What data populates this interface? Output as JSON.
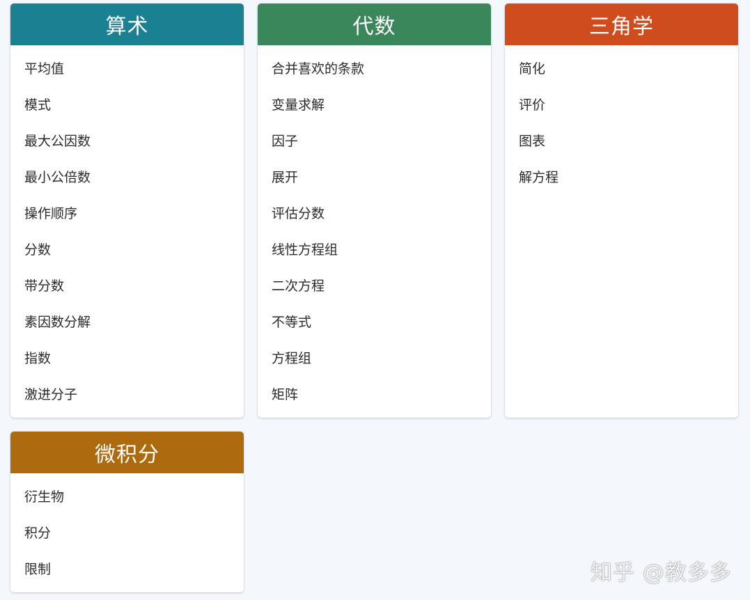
{
  "colors": {
    "arithmetic": "#1a8193",
    "algebra": "#3a875c",
    "trigonometry": "#cf4c1f",
    "calculus": "#ad6a0e",
    "background": "#f4f7fb"
  },
  "categories": [
    {
      "id": "arithmetic",
      "title": "算术",
      "items": [
        "平均值",
        "模式",
        "最大公因数",
        "最小公倍数",
        "操作顺序",
        "分数",
        "带分数",
        "素因数分解",
        "指数",
        "激进分子"
      ]
    },
    {
      "id": "algebra",
      "title": "代数",
      "items": [
        "合并喜欢的条款",
        "变量求解",
        "因子",
        "展开",
        "评估分数",
        "线性方程组",
        "二次方程",
        "不等式",
        "方程组",
        "矩阵"
      ]
    },
    {
      "id": "trigonometry",
      "title": "三角学",
      "items": [
        "简化",
        "评价",
        "图表",
        "解方程"
      ]
    },
    {
      "id": "calculus",
      "title": "微积分",
      "items": [
        "衍生物",
        "积分",
        "限制"
      ]
    }
  ],
  "watermark": "知乎 @教多多"
}
